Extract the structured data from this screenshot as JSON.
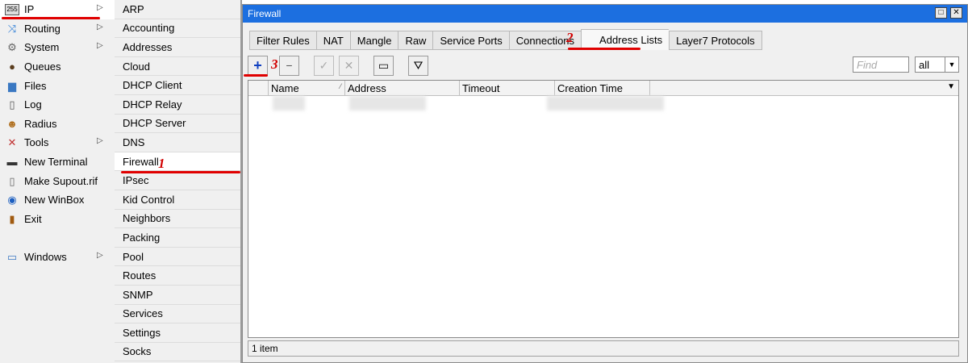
{
  "main_menu": {
    "items": [
      {
        "label": "IP",
        "icon": "ip-icon",
        "has_submenu": true
      },
      {
        "label": "Routing",
        "icon": "routing-icon",
        "has_submenu": true
      },
      {
        "label": "System",
        "icon": "gear-icon",
        "has_submenu": true
      },
      {
        "label": "Queues",
        "icon": "queues-icon",
        "has_submenu": false
      },
      {
        "label": "Files",
        "icon": "folder-icon",
        "has_submenu": false
      },
      {
        "label": "Log",
        "icon": "log-icon",
        "has_submenu": false
      },
      {
        "label": "Radius",
        "icon": "users-icon",
        "has_submenu": false
      },
      {
        "label": "Tools",
        "icon": "tools-icon",
        "has_submenu": true
      },
      {
        "label": "New Terminal",
        "icon": "terminal-icon",
        "has_submenu": false
      },
      {
        "label": "Make Supout.rif",
        "icon": "file-icon",
        "has_submenu": false
      },
      {
        "label": "New WinBox",
        "icon": "globe-icon",
        "has_submenu": false
      },
      {
        "label": "Exit",
        "icon": "exit-icon",
        "has_submenu": false
      },
      {
        "label": "Windows",
        "icon": "window-icon",
        "has_submenu": true
      }
    ],
    "arrow": "▷"
  },
  "sub_menu": {
    "items": [
      "ARP",
      "Accounting",
      "Addresses",
      "Cloud",
      "DHCP Client",
      "DHCP Relay",
      "DHCP Server",
      "DNS",
      "Firewall",
      "IPsec",
      "Kid Control",
      "Neighbors",
      "Packing",
      "Pool",
      "Routes",
      "SNMP",
      "Services",
      "Settings",
      "Socks"
    ]
  },
  "annotations": {
    "step1": "1",
    "step2": "2",
    "step3": "3"
  },
  "window": {
    "title": "Firewall",
    "tabs": [
      "Filter Rules",
      "NAT",
      "Mangle",
      "Raw",
      "Service Ports",
      "Connections",
      "Address Lists",
      "Layer7 Protocols"
    ],
    "active_tab": "Address Lists",
    "toolbar": {
      "add": "+",
      "remove": "−",
      "enable": "✓",
      "disable": "✕",
      "comment": "▭",
      "filter": "⛛"
    },
    "find_placeholder": "Find",
    "filter_value": "all",
    "columns": [
      "Name",
      "Address",
      "Timeout",
      "Creation Time"
    ],
    "status": "1 item"
  },
  "colors": {
    "titlebar": "#1c6fe0",
    "annotation": "#e00000"
  }
}
